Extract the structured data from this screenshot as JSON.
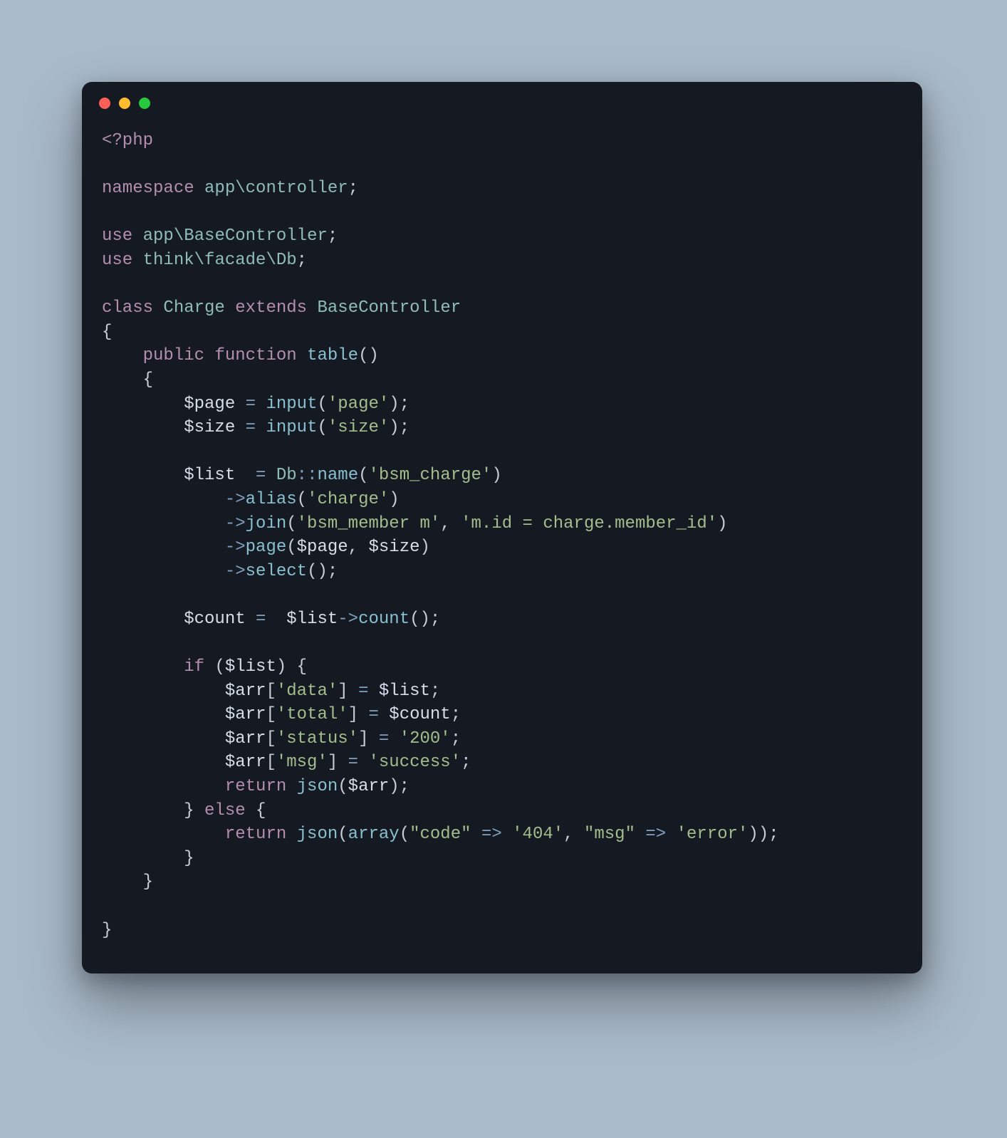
{
  "window": {
    "buttons": {
      "close": "close",
      "min": "minimize",
      "max": "maximize"
    }
  },
  "code": {
    "php_open": "<?php",
    "kw_namespace": "namespace",
    "ns": "app\\controller",
    "kw_use": "use",
    "use1": "app\\BaseController",
    "use2": "think\\facade\\Db",
    "kw_class": "class",
    "class_name": "Charge",
    "kw_extends": "extends",
    "base_class": "BaseController",
    "kw_public": "public",
    "kw_function": "function",
    "fn_table": "table",
    "var_page": "$page",
    "var_size": "$size",
    "var_list": "$list",
    "var_count": "$count",
    "var_arr": "$arr",
    "fn_input": "input",
    "cls_db": "Db",
    "fn_name": "name",
    "fn_alias": "alias",
    "fn_join": "join",
    "fn_page": "page",
    "fn_select": "select",
    "fn_count": "count",
    "kw_if": "if",
    "kw_else": "else",
    "kw_return": "return",
    "fn_json": "json",
    "fn_array": "array",
    "str_page": "'page'",
    "str_size": "'size'",
    "str_bsm_charge": "'bsm_charge'",
    "str_charge": "'charge'",
    "str_bsm_member_m": "'bsm_member m'",
    "str_join_cond": "'m.id = charge.member_id'",
    "str_data": "'data'",
    "str_total": "'total'",
    "str_status": "'status'",
    "str_200": "'200'",
    "str_msg": "'msg'",
    "str_success": "'success'",
    "str_code_dq": "\"code\"",
    "str_404": "'404'",
    "str_msg_dq": "\"msg\"",
    "str_error": "'error'"
  }
}
